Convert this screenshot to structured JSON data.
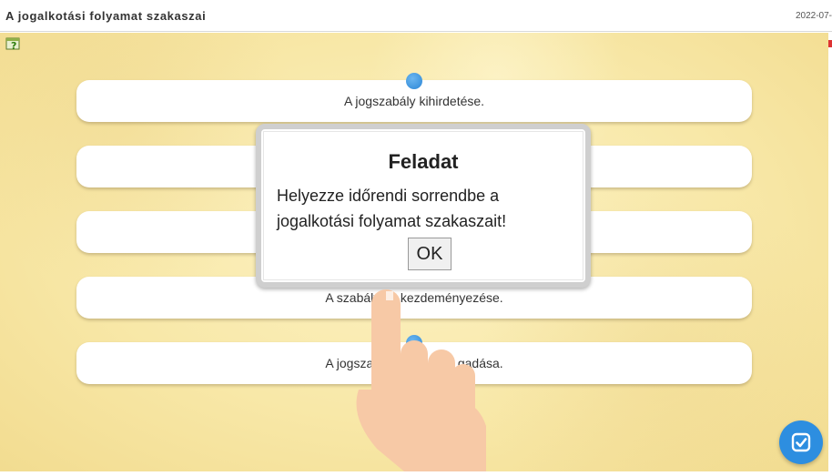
{
  "header": {
    "title": "A jogalkotási folyamat szakaszai",
    "date": "2022-07-"
  },
  "cards": [
    {
      "text": "A jogszabály kihirdetése."
    },
    {
      "text": ""
    },
    {
      "text": ""
    },
    {
      "text": "A szabályoz  kezdeményezése."
    },
    {
      "text": "A jogszabál                   gadása."
    }
  ],
  "dialog": {
    "title": "Feladat",
    "message": "Helyezze időrendi sorrendbe a jogalkotási folyamat szakaszait!",
    "ok_label": "OK"
  },
  "icons": {
    "help": "help-question-icon",
    "check": "check-square-icon",
    "hand": "pointing-hand-icon"
  },
  "colors": {
    "accent": "#2d8ee0",
    "background": "#f8e8a8"
  }
}
